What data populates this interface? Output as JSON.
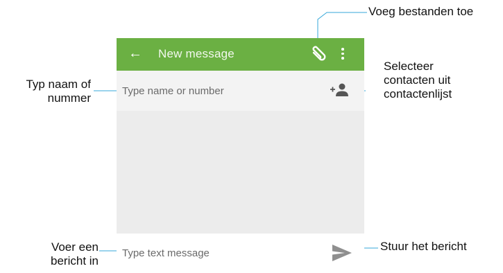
{
  "app": {
    "title": "New message",
    "accent_color": "#6bb043",
    "icons": {
      "back": "arrow-left-icon",
      "attach": "paperclip-icon",
      "more": "more-vert-icon",
      "add_contact": "add-person-icon",
      "send": "send-icon"
    }
  },
  "recipient": {
    "placeholder": "Type name or number"
  },
  "compose": {
    "placeholder": "Type text message"
  },
  "callouts": {
    "attach": "Voeg bestanden toe",
    "recipient": [
      "Typ naam of",
      "nummer"
    ],
    "contacts": [
      "Selecteer",
      "contacten uit",
      "contactenlijst"
    ],
    "compose": [
      "Voer een",
      "bericht in"
    ],
    "send": "Stuur het bericht"
  }
}
